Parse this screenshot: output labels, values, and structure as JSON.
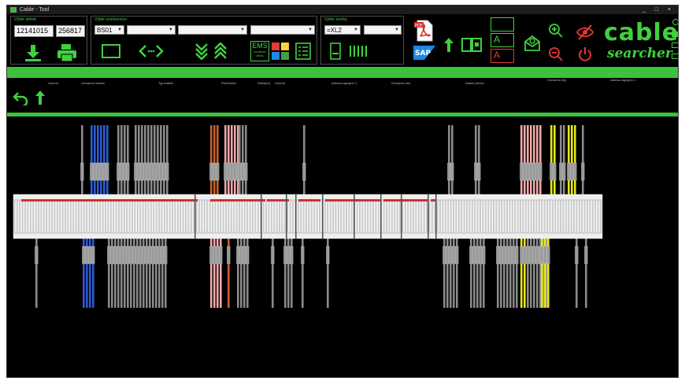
{
  "window": {
    "title": "Cable - Tool",
    "controls": "_ □ ×"
  },
  "groups": {
    "cabinet": {
      "title": "Výběr skříně",
      "value1": "12141015",
      "value2": "256817"
    },
    "terminal": {
      "title": "Výběr svorkovnice",
      "dd1": "BS01",
      "dd2": "",
      "dd3": "",
      "dd4": ""
    },
    "series": {
      "title": "Výběr svorky",
      "dd1": "=XL2",
      "dd2": ""
    }
  },
  "toolbar": {
    "ems_label": "EMS",
    "ems_sub": "conditions labels",
    "sap_label": "SAP",
    "pdf_label": "PDF",
    "a_label_1": "A",
    "a_label_2": "A"
  },
  "logo": {
    "line1": "cable",
    "line2": "searcher"
  },
  "colors": {
    "accent": "#3fd13f",
    "bar": "#3cc23c",
    "red_icon": "#e53935",
    "blue_cable": "#2c5bd3",
    "orange_cable": "#c8622c",
    "pink_cable": "#f0a7a7",
    "yellow_cable": "#e6e619"
  },
  "column_headers": [
    "Liknout",
    "Označení kabelu",
    "Typ kabelu",
    "Přerůznice",
    "Délka(m)",
    "Liknout",
    "Adresa zapojení 1",
    "Označení žíly",
    "Dalekí přívod",
    "Označení žíly",
    "Adresa zapojení 1"
  ],
  "icons": {
    "download": "download-icon",
    "print": "print-icon",
    "swap": "swap-arrows-icon",
    "expand": "double-chevron-down-icon",
    "collapse": "double-chevron-up-icon",
    "back": "back-arrow-icon",
    "up": "up-arrow-icon",
    "zoom_in": "zoom-in-icon",
    "zoom_out": "zoom-out-icon",
    "power": "power-icon",
    "mail": "mail-icon",
    "eye_off": "eye-off-icon"
  }
}
